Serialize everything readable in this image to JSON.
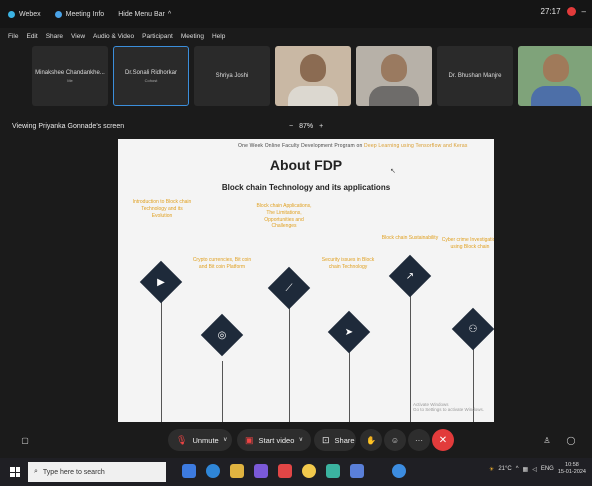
{
  "window": {
    "app_name": "Webex",
    "meeting_info": "Meeting Info",
    "hide_menu_bar": "Hide Menu Bar",
    "timer": "27:17",
    "minimize": "–",
    "menu": [
      "File",
      "Edit",
      "Share",
      "View",
      "Audio & Video",
      "Participant",
      "Meeting",
      "Help"
    ]
  },
  "participants": [
    {
      "name": "Minakshee Chandankhe...",
      "sub": "Me",
      "video": false
    },
    {
      "name": "Dr.Sonali Ridhorkar",
      "sub": "Cohost",
      "video": false,
      "active": true
    },
    {
      "name": "Shriya Joshi",
      "sub": "",
      "video": false
    },
    {
      "name": "",
      "sub": "",
      "video": true
    },
    {
      "name": "",
      "sub": "",
      "video": true
    },
    {
      "name": "Dr. Bhushan Manjre",
      "sub": "",
      "video": false
    },
    {
      "name": "",
      "sub": "",
      "video": true
    }
  ],
  "viewing": {
    "label": "Viewing Priyanka Gonnade's screen",
    "zoom": "87%",
    "zoom_out": "−",
    "zoom_in": "+"
  },
  "slide": {
    "header_prefix": "One Week Online Faculty Development Program on",
    "header_topic": "Deep Learning using Tensorflow and Keras",
    "title": "About FDP",
    "subtitle": "Block chain Technology and its applications",
    "topics": [
      "Introduction to Block chain Technology and its Evolution",
      "Crypto currencies, Bit coin and Bit coin Platform",
      "Block chain Applications, The Limitations, Opportunities and Challenges",
      "Security issues in Block chain Technology",
      "Block chain Sustainability",
      "Cyber crime Investigation using Block chain"
    ],
    "icons": [
      "play-icon",
      "target-icon",
      "chart-icon",
      "send-icon",
      "trend-icon",
      "people-icon"
    ],
    "watermark_line1": "Activate Windows",
    "watermark_line2": "Go to Settings to activate Windows."
  },
  "controls": {
    "unmute": "Unmute",
    "start_video": "Start video",
    "share": "Share"
  },
  "taskbar": {
    "search_placeholder": "Type here to search",
    "weather": "21°C",
    "language": "ENG",
    "time": "10:58",
    "date": "15-01-2024"
  },
  "colors": {
    "accent_blue": "#3b8edb",
    "end_red": "#e23b3b",
    "topic_orange": "#e0a020",
    "diamond_navy": "#1e2a3a"
  }
}
